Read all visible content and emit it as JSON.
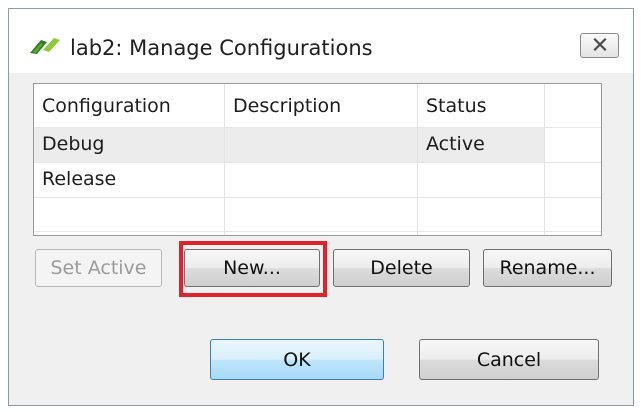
{
  "window": {
    "title": "lab2: Manage Configurations"
  },
  "table": {
    "headers": [
      "Configuration",
      "Description",
      "Status"
    ],
    "rows": [
      [
        "Debug",
        "",
        "Active"
      ],
      [
        "Release",
        "",
        ""
      ],
      [
        "",
        "",
        ""
      ]
    ]
  },
  "buttons": {
    "set_active": "Set Active",
    "new": "New...",
    "delete": "Delete",
    "rename": "Rename...",
    "ok": "OK",
    "cancel": "Cancel"
  },
  "colors": {
    "highlight": "#e0232b",
    "default_button": "#bee6fd"
  },
  "icons": {
    "app": "eclipse-style-app-icon",
    "close": "close-x-icon"
  }
}
